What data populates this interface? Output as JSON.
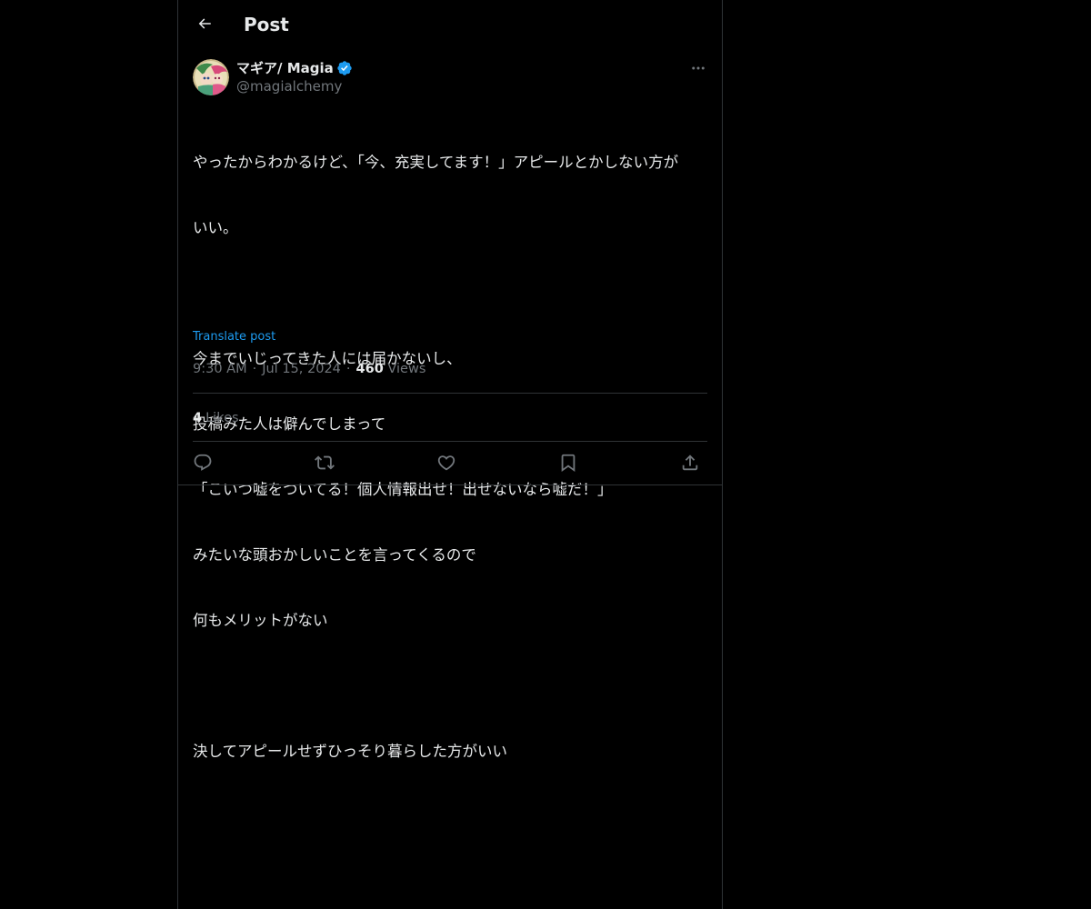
{
  "header": {
    "title": "Post",
    "back_icon": "arrow-left-icon"
  },
  "author": {
    "display_name": "マギア/ Magia",
    "handle": "@magialchemy",
    "verified": true,
    "verified_color": "#1d9bf0"
  },
  "post": {
    "lines": [
      "やったからわかるけど、「今、充実してます！」アピールとかしない方が",
      "いい。",
      "",
      "今までいじってきた人には届かないし、",
      "投稿みた人は僻んでしまって",
      "「こいつ嘘をついてる！個人情報出せ！出せないなら嘘だ！」",
      "みたいな頭おかしいことを言ってくるので",
      "何もメリットがない",
      "",
      "決してアピールせずひっそり暮らした方がいい"
    ],
    "translate_label": "Translate post",
    "time": "9:30 AM",
    "date": "Jul 15, 2024",
    "separator": "·",
    "views_count": "460",
    "views_label": "Views",
    "likes_count": "4",
    "likes_label": "Likes"
  },
  "actions": [
    {
      "name": "reply",
      "icon": "reply-icon"
    },
    {
      "name": "repost",
      "icon": "repost-icon"
    },
    {
      "name": "like",
      "icon": "heart-icon"
    },
    {
      "name": "bookmark",
      "icon": "bookmark-icon"
    },
    {
      "name": "share",
      "icon": "share-icon"
    }
  ],
  "colors": {
    "background": "#000000",
    "text_primary": "#e7e9ea",
    "text_secondary": "#71767b",
    "accent": "#1d9bf0",
    "border": "#2f3336"
  }
}
